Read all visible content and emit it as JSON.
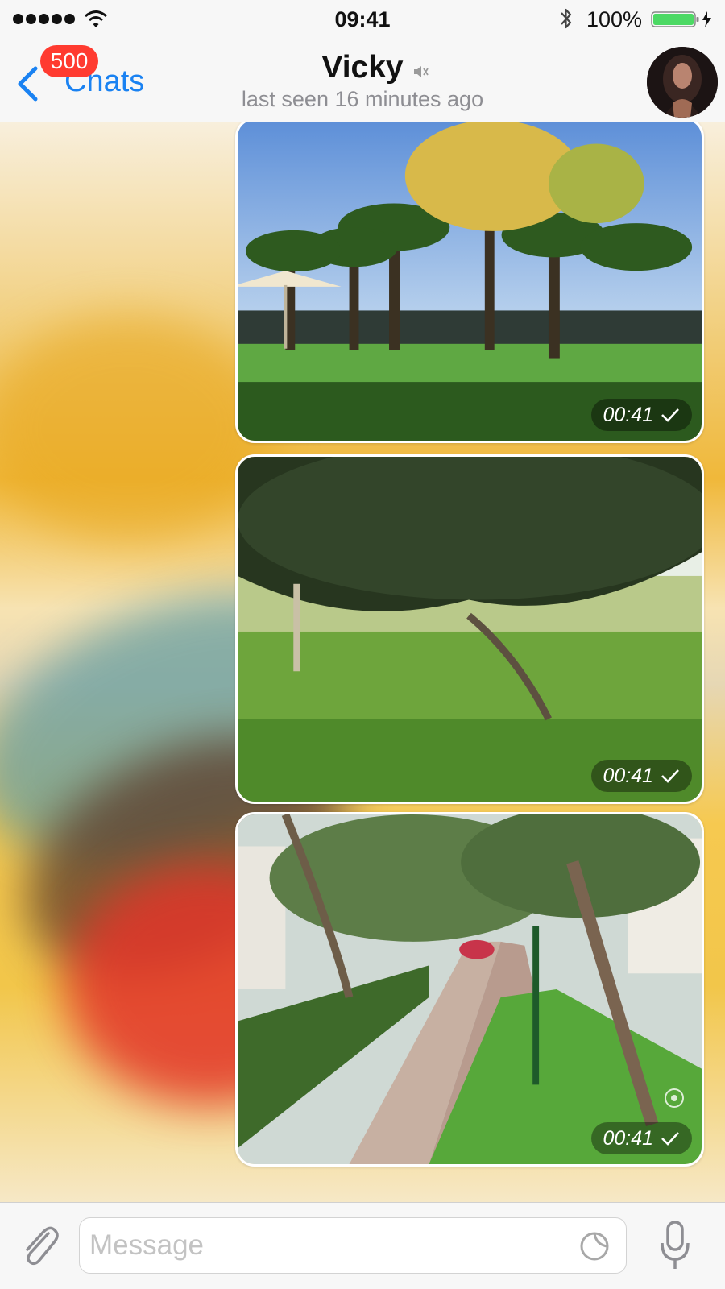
{
  "status_bar": {
    "time": "09:41",
    "battery_percent": "100%",
    "battery_level": 1.0,
    "signal_bars": 5,
    "icons": [
      "signal-dots-icon",
      "wifi-icon",
      "bluetooth-icon",
      "battery-icon",
      "charging-bolt-icon"
    ]
  },
  "nav": {
    "back_label": "Chats",
    "unread_badge": "500",
    "title": "Vicky",
    "title_icon": "mute-icon",
    "subtitle": "last seen 16 minutes ago",
    "avatar_icon": "contact-avatar"
  },
  "messages": [
    {
      "kind": "video",
      "scene": "palm trees, umbrella and lawn",
      "time": "00:41",
      "status_icon": "check-icon"
    },
    {
      "kind": "video",
      "scene": "tree canopy over lawn",
      "time": "00:41",
      "status_icon": "check-icon"
    },
    {
      "kind": "video",
      "scene": "garden path with shrubs",
      "time": "00:41",
      "status_icon": "check-icon",
      "views_icon": "views-eye-icon"
    }
  ],
  "input": {
    "placeholder": "Message",
    "value": "",
    "icons": [
      "attach-paperclip-icon",
      "sticker-icon",
      "microphone-icon"
    ]
  },
  "colors": {
    "accent": "#1a82f2",
    "badge": "#ff3b30",
    "battery": "#4cd964",
    "bar_background": "#f7f7f7"
  }
}
